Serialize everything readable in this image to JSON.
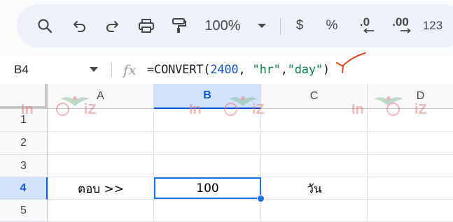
{
  "toolbar": {
    "zoom": "100%",
    "currency": "$",
    "percent": "%",
    "decrease_decimal": ".0",
    "increase_decimal": ".00",
    "number_format": "123"
  },
  "formula_bar": {
    "cell_ref": "B4",
    "fx": "fx",
    "formula_func": "=CONVERT(",
    "formula_num": "2400",
    "formula_sep1": ", ",
    "formula_str1": "\"hr\"",
    "formula_sep2": ",",
    "formula_str2": "\"day\"",
    "formula_end": ")"
  },
  "grid": {
    "columns": [
      "A",
      "B",
      "C",
      "D"
    ],
    "rows": [
      "1",
      "2",
      "3",
      "4",
      "5"
    ],
    "cells": {
      "A4": "ตอบ >>",
      "B4": "100",
      "C4": "วัน"
    }
  },
  "watermark": {
    "text_left": "In",
    "text_right": "iZ"
  },
  "colors": {
    "toolbar_bg": "#edf2fa",
    "selection": "#1a73e8",
    "active_header": "#d3e3fd",
    "formula_number": "#1155cc",
    "formula_string": "#0b8043",
    "annotation": "#e0461b"
  }
}
